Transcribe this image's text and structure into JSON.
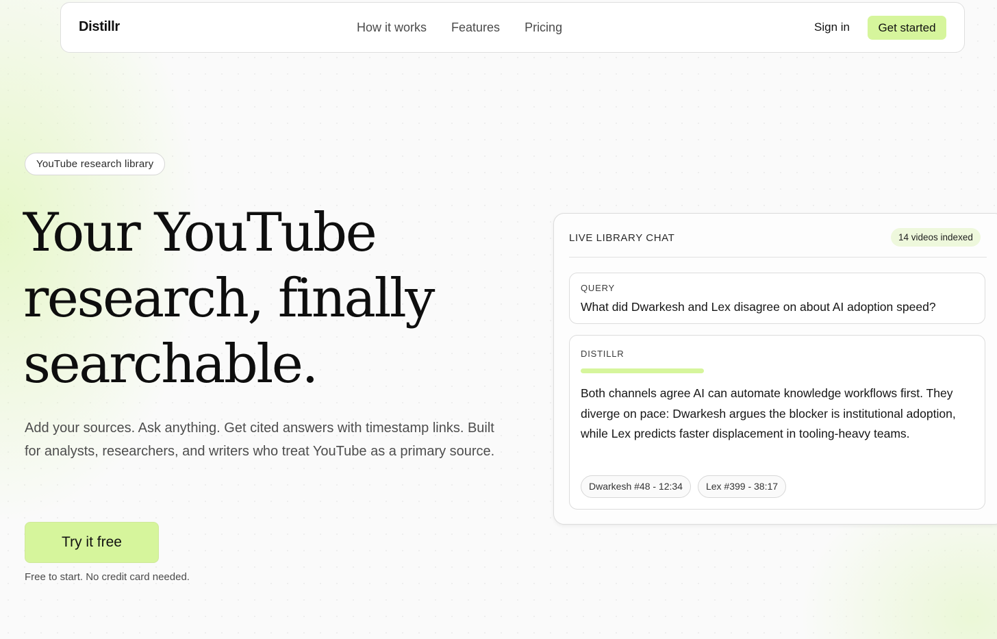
{
  "nav": {
    "brand": "Distillr",
    "links": [
      "How it works",
      "Features",
      "Pricing"
    ],
    "sign_in": "Sign in",
    "get_started": "Get started"
  },
  "hero": {
    "pill": "YouTube research library",
    "headline_lines": [
      "Your YouTube",
      "research, finally",
      "searchable."
    ],
    "subcopy": "Add your sources. Ask anything. Get cited answers with timestamp links. Built for analysts, researchers, and writers who treat YouTube as a primary source.",
    "cta": "Try it free",
    "fine_print": "Free to start. No credit card needed."
  },
  "chat": {
    "title": "LIVE LIBRARY CHAT",
    "badge": "14 videos indexed",
    "query_label": "QUERY",
    "query_text": "What did Dwarkesh and Lex disagree on about AI adoption speed?",
    "answer_label": "DISTILLR",
    "answer_text": "Both channels agree AI can automate knowledge workflows first. They diverge on pace: Dwarkesh argues the blocker is institutional adoption, while Lex predicts faster displacement in tooling-heavy teams.",
    "citations": [
      "Dwarkesh #48 - 12:34",
      "Lex #399 - 38:17"
    ]
  },
  "colors": {
    "accent": "#d6f59c",
    "background": "#fafafa",
    "text": "#141414"
  }
}
